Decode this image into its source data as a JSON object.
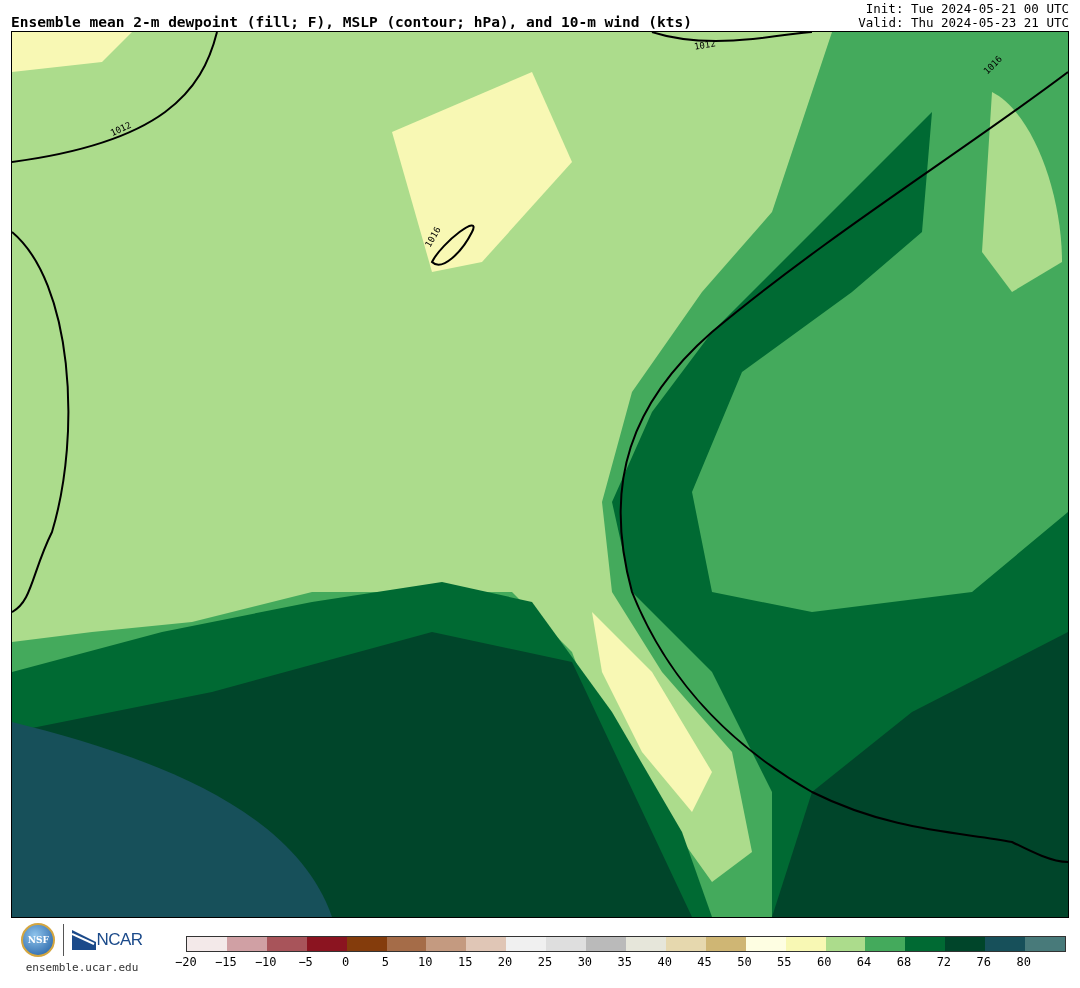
{
  "header": {
    "title": "Ensemble mean 2-m dewpoint (fill; F), MSLP (contour; hPa), and 10-m wind (kts)",
    "init": "Init: Tue 2024-05-21 00 UTC",
    "valid": "Valid: Thu 2024-05-23 21 UTC"
  },
  "map": {
    "contour_labels": [
      "1012",
      "1012",
      "1016",
      "1016"
    ]
  },
  "footer": {
    "logos": {
      "nsf": "NSF",
      "ncar": "NCAR"
    },
    "site": "ensemble.ucar.edu"
  },
  "colorbar": {
    "swatches": [
      {
        "color": "#f3e9e9"
      },
      {
        "color": "#d0a0a4"
      },
      {
        "color": "#a8545a"
      },
      {
        "color": "#8b1420"
      },
      {
        "color": "#843c0c"
      },
      {
        "color": "#a56c48"
      },
      {
        "color": "#c49a80"
      },
      {
        "color": "#e0c6b6"
      },
      {
        "color": "#f0f0f0"
      },
      {
        "color": "#dedede"
      },
      {
        "color": "#bababa"
      },
      {
        "color": "#e6e6da"
      },
      {
        "color": "#e6d8ae"
      },
      {
        "color": "#cfb674"
      },
      {
        "color": "#fefee2"
      },
      {
        "color": "#f8f8b4"
      },
      {
        "color": "#acdc8c"
      },
      {
        "color": "#44aa5c"
      },
      {
        "color": "#006a33"
      },
      {
        "color": "#00452a"
      },
      {
        "color": "#17505a"
      },
      {
        "color": "#487a7a"
      }
    ],
    "labels": [
      "−20",
      "−15",
      "−10",
      "−5",
      "0",
      "5",
      "10",
      "15",
      "20",
      "25",
      "30",
      "35",
      "40",
      "45",
      "50",
      "55",
      "60",
      "64",
      "68",
      "72",
      "76",
      "80"
    ]
  }
}
